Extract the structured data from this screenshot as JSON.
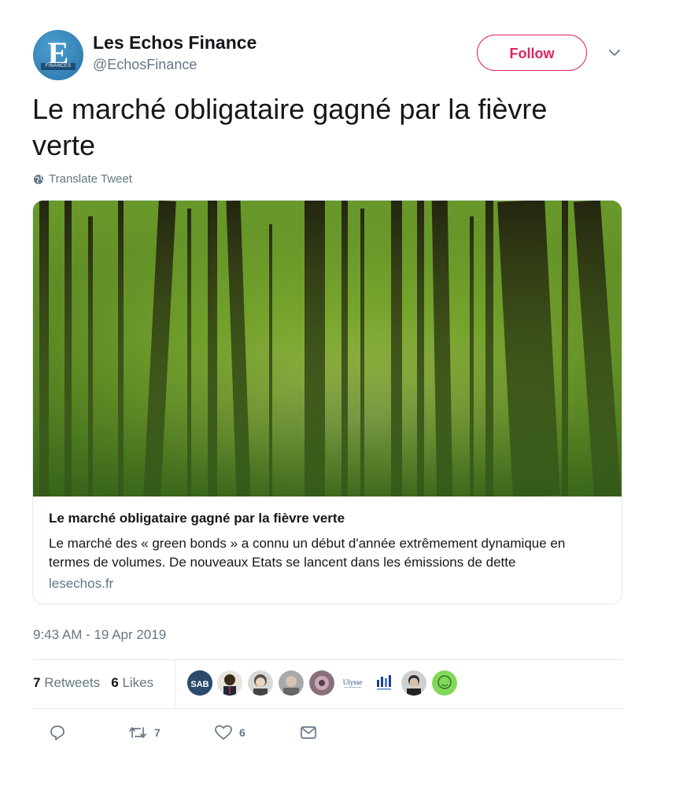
{
  "author": {
    "name": "Les Echos Finance",
    "handle": "@EchosFinance",
    "avatar_letter": "E",
    "avatar_strip": "FINANCES",
    "avatar_icon": "les-echos-logo-icon"
  },
  "follow_label": "Follow",
  "tweet": {
    "text": "Le marché obligataire gagné par la fièvre verte",
    "translate_label": "Translate Tweet",
    "timestamp": "9:43 AM - 19 Apr 2019"
  },
  "link_card": {
    "title": "Le marché obligataire gagné par la fièvre verte",
    "description": "Le marché des « green bonds » a connu un début d'année extrêmement dynamique en termes de volumes. De nouveaux Etats se lancent dans les émissions de dette",
    "domain": "lesechos.fr",
    "image": "forest-photo"
  },
  "stats": {
    "retweets_count": "7",
    "retweets_label": "Retweets",
    "likes_count": "6",
    "likes_label": "Likes"
  },
  "likers": [
    {
      "name": "liker-avatar-1",
      "label": "SAB",
      "color": "#2c4a6e"
    },
    {
      "name": "liker-avatar-2",
      "color": "#7a5a3a"
    },
    {
      "name": "liker-avatar-3",
      "color": "#9a9a9a"
    },
    {
      "name": "liker-avatar-4",
      "color": "#b0b0b0"
    },
    {
      "name": "liker-avatar-5",
      "color": "#8a6f7a"
    },
    {
      "name": "liker-avatar-6",
      "label": "Ulysse",
      "color": "#ffffff"
    },
    {
      "name": "liker-avatar-7",
      "color": "#ffffff"
    },
    {
      "name": "liker-avatar-8",
      "color": "#555555"
    },
    {
      "name": "liker-avatar-9",
      "color": "#7ed957"
    }
  ],
  "actions": {
    "reply_icon": "reply-icon",
    "retweet_icon": "retweet-icon",
    "retweet_count": "7",
    "like_icon": "heart-icon",
    "like_count": "6",
    "message_icon": "envelope-icon"
  },
  "colors": {
    "follow_accent": "#e0245e",
    "secondary_text": "#657786",
    "primary_text": "#14171a",
    "border": "#e1e8ed"
  }
}
